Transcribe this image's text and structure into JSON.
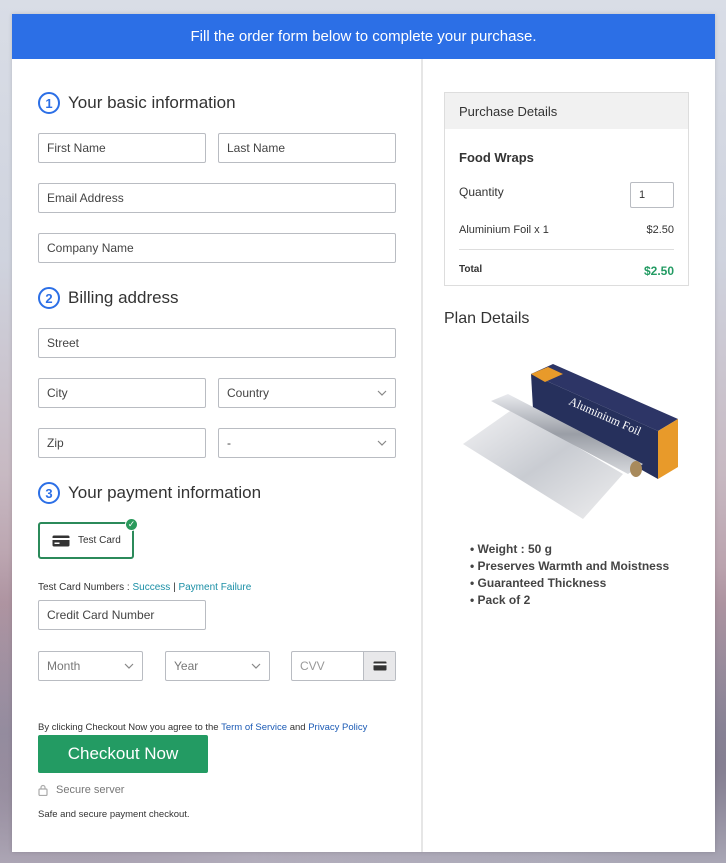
{
  "banner": "Fill the order form below to complete your purchase.",
  "sections": {
    "basic": {
      "num": "1",
      "title": "Your basic information"
    },
    "billing": {
      "num": "2",
      "title": "Billing address"
    },
    "payment": {
      "num": "3",
      "title": "Your payment information"
    }
  },
  "fields": {
    "first_name": "First Name",
    "last_name": "Last Name",
    "email": "Email Address",
    "company": "Company Name",
    "street": "Street",
    "city": "City",
    "country": "Country",
    "zip": "Zip",
    "state": "-",
    "card_number": "Credit Card Number",
    "month": "Month",
    "year": "Year",
    "cvv": "CVV"
  },
  "payment": {
    "card_label": "Test Card",
    "test_numbers_label": "Test Card Numbers :",
    "success": "Success",
    "separator": "|",
    "failure": "Payment Failure"
  },
  "terms": {
    "prefix": "By clicking Checkout Now you agree to the",
    "tos": "Term of Service",
    "and": "and",
    "privacy": "Privacy Policy"
  },
  "checkout_label": "Checkout Now",
  "secure_label": "Secure server",
  "secure_note": "Safe and secure payment checkout.",
  "purchase": {
    "heading": "Purchase Details",
    "product": "Food Wraps",
    "quantity_label": "Quantity",
    "quantity_value": "1",
    "line_item": "Aluminium Foil x 1",
    "line_price": "$2.50",
    "total_label": "Total",
    "total_price": "$2.50"
  },
  "plan": {
    "heading": "Plan Details",
    "product_box_text": "Aluminium Foil",
    "features": [
      "Weight : 50 g",
      "Preserves Warmth and Moistness",
      "Guaranteed Thickness",
      "Pack of 2"
    ]
  },
  "colors": {
    "accent": "#2c6fe6",
    "button": "#239b63",
    "total": "#239b63"
  }
}
